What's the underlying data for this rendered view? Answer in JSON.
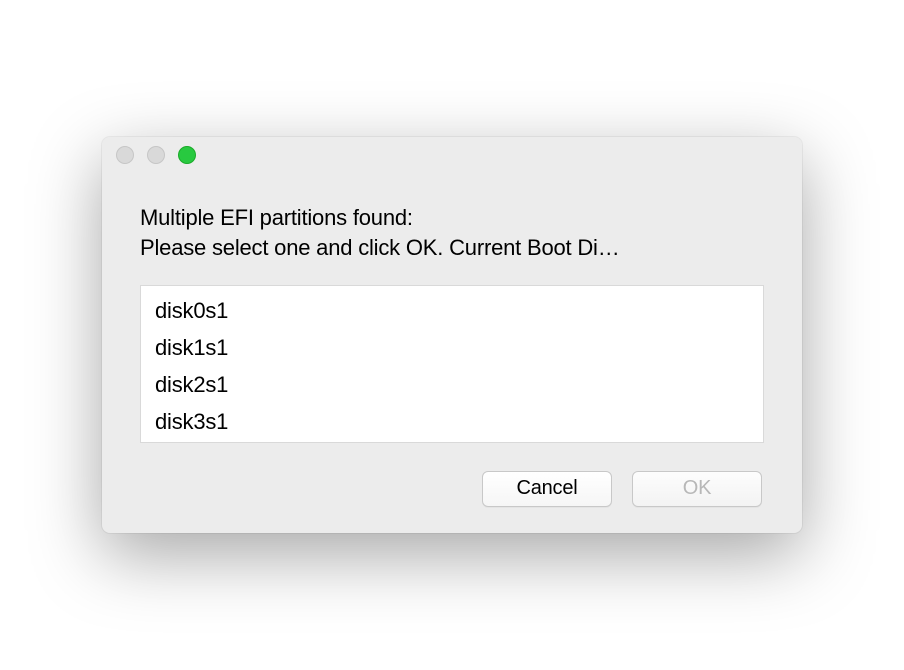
{
  "dialog": {
    "title_line1": "Multiple EFI partitions found:",
    "title_line2": "Please select one and click OK. Current Boot Di…",
    "partitions": [
      "disk0s1",
      "disk1s1",
      "disk2s1",
      "disk3s1"
    ],
    "buttons": {
      "cancel": "Cancel",
      "ok": "OK"
    },
    "ok_enabled": false
  }
}
